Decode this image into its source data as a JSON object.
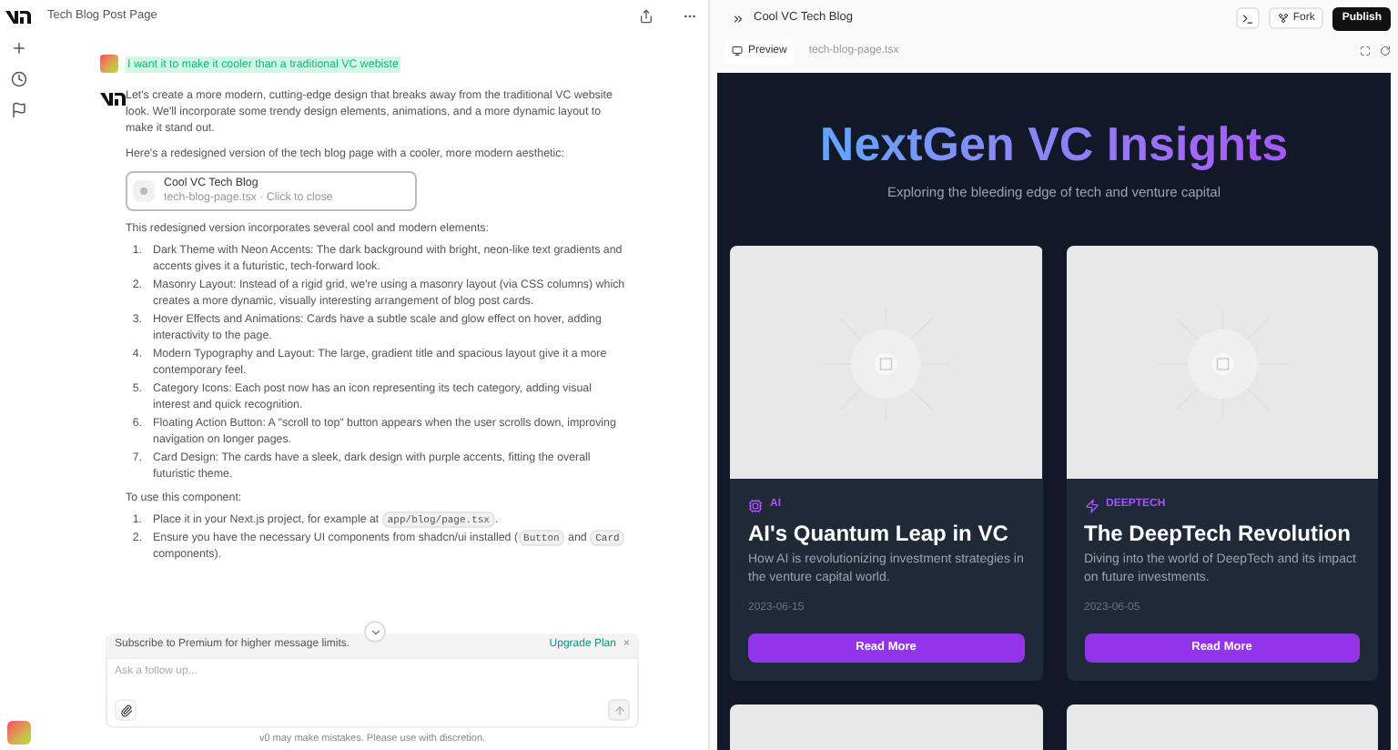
{
  "chat": {
    "title": "Tech Blog Post Page",
    "user_message": "I want it to make it cooler than a traditional VC webiste",
    "intro": "Let's create a more modern, cutting-edge design that breaks away from the traditional VC website look. We'll incorporate some trendy design elements, animations, and a more dynamic layout to make it stand out.",
    "lead": "Here's a redesigned version of the tech blog page with a cooler, more modern aesthetic:",
    "attachment": {
      "title": "Cool VC Tech Blog",
      "subtitle": "tech-blog-page.tsx · Click to close"
    },
    "features_intro": "This redesigned version incorporates several cool and modern elements:",
    "features": [
      {
        "marker": "1.",
        "text": "Dark Theme with Neon Accents: The dark background with bright, neon-like text gradients and accents gives it a futuristic, tech-forward look."
      },
      {
        "marker": "2.",
        "text": "Masonry Layout: Instead of a rigid grid, we're using a masonry layout (via CSS columns) which creates a more dynamic, visually interesting arrangement of blog post cards."
      },
      {
        "marker": "3.",
        "text": "Hover Effects and Animations: Cards have a subtle scale and glow effect on hover, adding interactivity to the page."
      },
      {
        "marker": "4.",
        "text": "Modern Typography and Layout: The large, gradient title and spacious layout give it a more contemporary feel."
      },
      {
        "marker": "5.",
        "text": "Category Icons: Each post now has an icon representing its tech category, adding visual interest and quick recognition."
      },
      {
        "marker": "6.",
        "text": "Floating Action Button: A \"scroll to top\" button appears when the user scrolls down, improving navigation on longer pages."
      },
      {
        "marker": "7.",
        "text": "Card Design: The cards have a sleek, dark design with purple accents, fitting the overall futuristic theme."
      }
    ],
    "usage_intro": "To use this component:",
    "steps": [
      {
        "marker": "1.",
        "parts": [
          {
            "kind": "text",
            "text": "Place it in your Next.js project, for example at "
          },
          {
            "kind": "code",
            "text": "app/blog/page.tsx"
          },
          {
            "kind": "text",
            "text": "."
          }
        ]
      },
      {
        "marker": "2.",
        "parts": [
          {
            "kind": "text",
            "text": "Ensure you have the necessary UI components from shadcn/ui installed ("
          },
          {
            "kind": "code",
            "text": "Button"
          },
          {
            "kind": "text",
            "text": " and "
          },
          {
            "kind": "code",
            "text": "Card"
          },
          {
            "kind": "text",
            "text": " components)."
          }
        ]
      }
    ],
    "banner": {
      "text": "Subscribe to Premium for higher message limits.",
      "link": "Upgrade Plan",
      "close": "×"
    },
    "input": {
      "placeholder": "Ask a follow up..."
    },
    "disclaimer": "v0 may make mistakes. Please use with discretion."
  },
  "preview": {
    "title": "Cool VC Tech Blog",
    "fork": "Fork",
    "publish": "Publish",
    "tabs": [
      {
        "label": "Preview",
        "selected": true
      },
      {
        "label": "tech-blog-page.tsx",
        "selected": false
      }
    ],
    "heading": "NextGen VC Insights",
    "subheading": "Exploring the bleeding edge of tech and venture capital",
    "posts": [
      {
        "category": "AI",
        "title": "AI's Quantum Leap in VC",
        "excerpt": "How AI is revolutionizing investment strategies in the venture capital world.",
        "date": "2023-06-15",
        "button": "Read More"
      },
      {
        "category": "DEEPTECH",
        "title": "The DeepTech Revolution",
        "excerpt": "Diving into the world of DeepTech and its impact on future investments.",
        "date": "2023-06-05",
        "button": "Read More"
      }
    ]
  }
}
